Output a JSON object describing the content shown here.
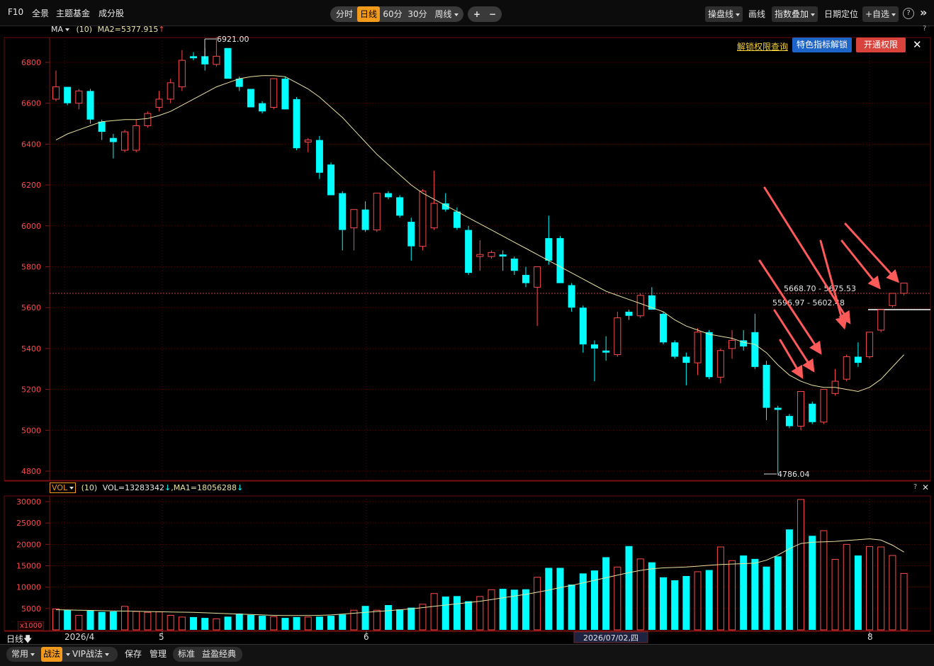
{
  "topbar": {
    "f10": "F10",
    "items": [
      "全景",
      "主题基金",
      "成分股"
    ],
    "periods": [
      "分时",
      "日线",
      "60分",
      "30分",
      "周线"
    ],
    "active_period": "日线",
    "zoom_in": "+",
    "zoom_out": "−",
    "tools": {
      "panel_line": "操盘线",
      "draw": "画线",
      "index_overlay": "指数叠加",
      "date_locate": "日期定位",
      "add_watch": "+自选"
    },
    "help": "?",
    "collapse": "»"
  },
  "main_header": {
    "indicator": "MA",
    "param": "(10)",
    "ma_label": "MA2=5377.915",
    "ma_arrow": "↑",
    "help": "?"
  },
  "promo": {
    "link": "解锁权限查询",
    "feature_button": "特色指标解锁",
    "open_button": "开通权限",
    "close": "✕"
  },
  "annotations": {
    "high_label": "6921.00",
    "low_label": "4786.04",
    "range_1": "5668.70 - 5675.53",
    "range_2": "5596.97 - 5602.48"
  },
  "vol_header": {
    "indicator": "VOL",
    "param": "(10)",
    "vol_label": "VOL=13283342",
    "vol_arrow": "↓",
    "ma_label": ",MA1=18056288",
    "ma_arrow": "↓",
    "help": "?",
    "close": "✕"
  },
  "vol_unit": "x1000",
  "date_axis": {
    "period_label": "日线",
    "labels": [
      "2026/4",
      "5",
      "6",
      "8"
    ],
    "cursor_date": "2026/07/02,四"
  },
  "bottombar": {
    "tabs": [
      "常用",
      "战法",
      "VIP战法"
    ],
    "active_tab": "战法",
    "buttons": [
      "保存",
      "管理"
    ],
    "modes": [
      "标准",
      "益盈经典"
    ]
  },
  "colors": {
    "up": "#ff4a4a",
    "down": "#00ffff",
    "ma": "#e8e2a0",
    "grid": "#5a0a0a",
    "axis_text": "#ff4a4a",
    "accent": "#f19a1b"
  },
  "chart_data": [
    {
      "type": "candlestick",
      "title": "",
      "y_ticks": [
        4800,
        5000,
        5200,
        5400,
        5600,
        5800,
        6000,
        6200,
        6400,
        6600,
        6800
      ],
      "ylim": [
        4760,
        6900
      ],
      "grid": true,
      "ohlc": [
        [
          6620,
          6760,
          6610,
          6680
        ],
        [
          6680,
          6680,
          6590,
          6600
        ],
        [
          6600,
          6670,
          6570,
          6660
        ],
        [
          6660,
          6670,
          6500,
          6520
        ],
        [
          6510,
          6520,
          6420,
          6460
        ],
        [
          6430,
          6450,
          6330,
          6410
        ],
        [
          6370,
          6470,
          6360,
          6460
        ],
        [
          6370,
          6520,
          6360,
          6490
        ],
        [
          6490,
          6560,
          6480,
          6550
        ],
        [
          6580,
          6660,
          6560,
          6620
        ],
        [
          6620,
          6720,
          6600,
          6700
        ],
        [
          6680,
          6860,
          6660,
          6810
        ],
        [
          6830,
          6850,
          6810,
          6820
        ],
        [
          6830,
          6870,
          6760,
          6790
        ],
        [
          6790,
          6921,
          6780,
          6830
        ],
        [
          6870,
          6870,
          6720,
          6720
        ],
        [
          6720,
          6730,
          6660,
          6680
        ],
        [
          6670,
          6670,
          6580,
          6580
        ],
        [
          6600,
          6610,
          6550,
          6560
        ],
        [
          6580,
          6720,
          6570,
          6720
        ],
        [
          6720,
          6730,
          6570,
          6570
        ],
        [
          6620,
          6630,
          6370,
          6380
        ],
        [
          6410,
          6430,
          6360,
          6420
        ],
        [
          6420,
          6440,
          6230,
          6260
        ],
        [
          6300,
          6310,
          6150,
          6150
        ],
        [
          6160,
          6170,
          5880,
          5980
        ],
        [
          5990,
          6080,
          5880,
          6080
        ],
        [
          6080,
          6120,
          5970,
          5980
        ],
        [
          5980,
          6160,
          5970,
          6160
        ],
        [
          6160,
          6170,
          6130,
          6140
        ],
        [
          6140,
          6150,
          6040,
          6050
        ],
        [
          6020,
          6040,
          5830,
          5900
        ],
        [
          5900,
          6180,
          5880,
          6170
        ],
        [
          5990,
          6270,
          5980,
          6110
        ],
        [
          6110,
          6160,
          6070,
          6080
        ],
        [
          6070,
          6090,
          5980,
          5990
        ],
        [
          5980,
          6000,
          5760,
          5770
        ],
        [
          5850,
          5930,
          5780,
          5860
        ],
        [
          5850,
          5880,
          5840,
          5870
        ],
        [
          5860,
          5880,
          5780,
          5850
        ],
        [
          5840,
          5850,
          5760,
          5780
        ],
        [
          5760,
          5800,
          5700,
          5720
        ],
        [
          5700,
          5800,
          5510,
          5800
        ],
        [
          5940,
          6050,
          5810,
          5830
        ],
        [
          5940,
          5950,
          5720,
          5720
        ],
        [
          5710,
          5720,
          5580,
          5600
        ],
        [
          5600,
          5610,
          5380,
          5420
        ],
        [
          5420,
          5440,
          5240,
          5400
        ],
        [
          5390,
          5460,
          5340,
          5380
        ],
        [
          5370,
          5580,
          5360,
          5550
        ],
        [
          5580,
          5590,
          5540,
          5560
        ],
        [
          5560,
          5670,
          5550,
          5660
        ],
        [
          5660,
          5700,
          5590,
          5590
        ],
        [
          5570,
          5580,
          5420,
          5430
        ],
        [
          5430,
          5440,
          5350,
          5360
        ],
        [
          5360,
          5380,
          5220,
          5330
        ],
        [
          5330,
          5500,
          5270,
          5480
        ],
        [
          5480,
          5490,
          5250,
          5260
        ],
        [
          5260,
          5400,
          5230,
          5390
        ],
        [
          5400,
          5490,
          5350,
          5440
        ],
        [
          5440,
          5490,
          5390,
          5410
        ],
        [
          5480,
          5570,
          5300,
          5310
        ],
        [
          5320,
          5340,
          5050,
          5110
        ],
        [
          5110,
          5120,
          4786.04,
          5100
        ],
        [
          5070,
          5080,
          5010,
          5020
        ],
        [
          5020,
          5190,
          5000,
          5190
        ],
        [
          5130,
          5140,
          5030,
          5040
        ],
        [
          5040,
          5200,
          5030,
          5200
        ],
        [
          5180,
          5300,
          5170,
          5240
        ],
        [
          5250,
          5370,
          5240,
          5360
        ],
        [
          5360,
          5430,
          5310,
          5330
        ],
        [
          5360,
          5480,
          5350,
          5480
        ],
        [
          5490,
          5590,
          5480,
          5590
        ],
        [
          5610,
          5670,
          5600,
          5670
        ],
        [
          5670,
          5720,
          5660,
          5720
        ]
      ],
      "ma_line": [
        6420,
        6450,
        6470,
        6490,
        6510,
        6515,
        6520,
        6520,
        6525,
        6540,
        6560,
        6590,
        6620,
        6650,
        6680,
        6700,
        6720,
        6730,
        6735,
        6735,
        6730,
        6700,
        6670,
        6630,
        6580,
        6530,
        6470,
        6410,
        6350,
        6300,
        6250,
        6200,
        6160,
        6130,
        6100,
        6070,
        6040,
        6010,
        5980,
        5950,
        5920,
        5890,
        5860,
        5830,
        5800,
        5770,
        5740,
        5710,
        5680,
        5660,
        5640,
        5620,
        5600,
        5580,
        5540,
        5510,
        5490,
        5470,
        5460,
        5450,
        5430,
        5420,
        5380,
        5320,
        5270,
        5240,
        5220,
        5210,
        5210,
        5200,
        5190,
        5210,
        5250,
        5310,
        5370
      ],
      "high_marker": 6921.0,
      "low_marker": 4786.04
    },
    {
      "type": "bar",
      "title": "",
      "y_ticks": [
        5000,
        10000,
        15000,
        20000,
        25000,
        30000
      ],
      "ylim": [
        0,
        32000
      ],
      "unit": "x1000",
      "values": [
        4900,
        4700,
        3400,
        4500,
        4200,
        4300,
        5500,
        4300,
        4100,
        4200,
        3400,
        3000,
        3000,
        2800,
        2600,
        3100,
        3800,
        3500,
        3300,
        3100,
        2800,
        3000,
        3000,
        3100,
        3300,
        3600,
        4600,
        5600,
        4600,
        5800,
        4800,
        5200,
        6000,
        8500,
        7800,
        7900,
        6700,
        7800,
        9400,
        9600,
        9400,
        9500,
        12300,
        14500,
        14500,
        10600,
        13200,
        13900,
        17000,
        14700,
        19600,
        16600,
        15800,
        12300,
        11600,
        12600,
        13600,
        14000,
        19400,
        16200,
        17400,
        16600,
        14800,
        17200,
        23500,
        31000,
        22000,
        23200,
        16500,
        20000,
        17400,
        19500,
        19400,
        17400,
        13200
      ],
      "ma_line": [
        4700,
        4650,
        4600,
        4550,
        4500,
        4450,
        4400,
        4350,
        4300,
        4250,
        4200,
        4150,
        4100,
        4000,
        3900,
        3800,
        3700,
        3600,
        3500,
        3400,
        3350,
        3350,
        3350,
        3400,
        3500,
        3700,
        3900,
        4100,
        4300,
        4500,
        4700,
        4900,
        5200,
        5500,
        5800,
        6100,
        6400,
        6700,
        7100,
        7500,
        7900,
        8300,
        8800,
        9300,
        9900,
        10400,
        11000,
        11600,
        12200,
        12800,
        13400,
        13900,
        14300,
        14500,
        14600,
        14700,
        14900,
        15100,
        15300,
        15400,
        15500,
        15600,
        16300,
        17500,
        19000,
        20200,
        20500,
        20600,
        20700,
        20900,
        21100,
        21300,
        21000,
        19800,
        18200
      ]
    }
  ]
}
